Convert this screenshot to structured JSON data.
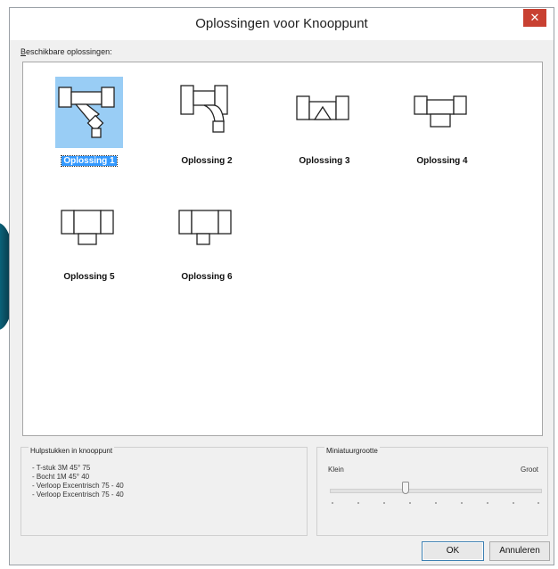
{
  "window": {
    "title": "Oplossingen voor Knooppunt",
    "close_glyph": "✕"
  },
  "list": {
    "label_accel": "B",
    "label_rest": "eschikbare oplossingen:",
    "items": [
      {
        "label": "Oplossing 1",
        "icon": "tee-45-with-bend-icon",
        "selected": true
      },
      {
        "label": "Oplossing 2",
        "icon": "tee-with-bend-icon",
        "selected": false
      },
      {
        "label": "Oplossing 3",
        "icon": "tee-with-cone-icon",
        "selected": false
      },
      {
        "label": "Oplossing 4",
        "icon": "tee-with-reducer-icon",
        "selected": false
      },
      {
        "label": "Oplossing 5",
        "icon": "tee-with-short-reducer-icon",
        "selected": false
      },
      {
        "label": "Oplossing 6",
        "icon": "tee-with-side-reducer-icon",
        "selected": false
      }
    ]
  },
  "parts": {
    "title": "Hulpstukken in knooppunt",
    "items": [
      "- T-stuk 3M 45° 75",
      "- Bocht 1M 45° 40",
      "- Verloop Excentrisch 75 - 40",
      "- Verloop Excentrisch 75 - 40"
    ]
  },
  "thumbsize": {
    "title": "Miniatuurgrootte",
    "min_label": "Klein",
    "max_label": "Groot",
    "value_fraction": 0.38
  },
  "buttons": {
    "ok": "OK",
    "cancel": "Annuleren"
  },
  "colors": {
    "selection": "#3399ff",
    "selection_bg": "#99cdf5",
    "close": "#c84031"
  }
}
